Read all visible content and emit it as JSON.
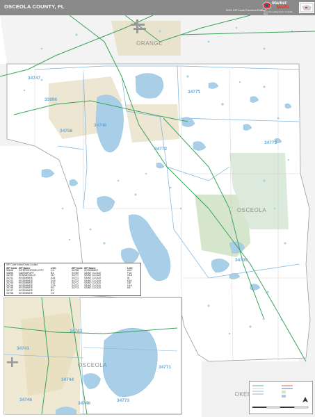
{
  "header": {
    "title": "OSCEOLA COUNTY, FL",
    "edition": "2021 ZIP Code Premium Edition",
    "logo_wordmark": "Market",
    "logo_second": "MAPS",
    "logo_tagline": "America's Leading Source of Quality Maps",
    "topright_text": "",
    "bar_color": "#8a8a8a"
  },
  "map": {
    "region_labels": {
      "orange": "ORANGE",
      "osceola_main": "OSCEOLA",
      "osceola_inset": "OSCEOLA",
      "okeechobee": "OKEECHOBEE"
    },
    "zip_labels": {
      "z1": "34747",
      "z2": "33896",
      "z3": "34771",
      "z4": "34758",
      "z5": "34746",
      "z6": "34772",
      "z7": "34773",
      "z8": "34739",
      "z9": "34743",
      "z10": "34741",
      "z11": "34744",
      "z12": "34771",
      "z13": "34746",
      "z14": "34746",
      "z15": "34773"
    },
    "colors": {
      "water": "#a9cfe8",
      "zip_boundary": "#7ab1dd",
      "road_green": "#3aa35a",
      "park": "#d8e8d0",
      "urban": "#e8e0c8",
      "county_line": "#9a9a9a"
    }
  },
  "legend": {
    "title": "ZIP Code Index/Cross Locator",
    "headers": [
      "ZIP Code",
      "ZIP Name",
      "LOC",
      "ZIP Code",
      "ZIP Name",
      "LOC"
    ],
    "rows": [
      [
        "33848",
        "INTERCESSION CITY",
        "C4",
        "34758",
        "KISSIMMEE",
        "A19"
      ],
      [
        "33896",
        "DAVENPORT",
        "B4",
        "34769",
        "SAINT CLOUD",
        "F18"
      ],
      [
        "34739",
        "KENANSVILLE",
        "J17",
        "34771",
        "SAINT CLOUD",
        "G18"
      ],
      [
        "34741",
        "KISSIMMEE",
        "A16",
        "34771",
        "SAINT CLOUD",
        "I8"
      ],
      [
        "34743",
        "KISSIMMEE",
        "D15",
        "34772",
        "SAINT CLOUD",
        "E18"
      ],
      [
        "34744",
        "KISSIMMEE",
        "E16",
        "34772",
        "SAINT CLOUD",
        "G8"
      ],
      [
        "34746",
        "KISSIMMEE",
        "C18",
        "34773",
        "SAINT CLOUD",
        "H18"
      ],
      [
        "34746",
        "KISSIMMEE",
        "E5",
        "34773",
        "SAINT CLOUD",
        "K8"
      ],
      [
        "34747",
        "KISSIMMEE",
        "B3",
        "",
        "",
        ""
      ],
      [
        "34758",
        "KISSIMMEE",
        "C5",
        "",
        "",
        ""
      ]
    ]
  }
}
